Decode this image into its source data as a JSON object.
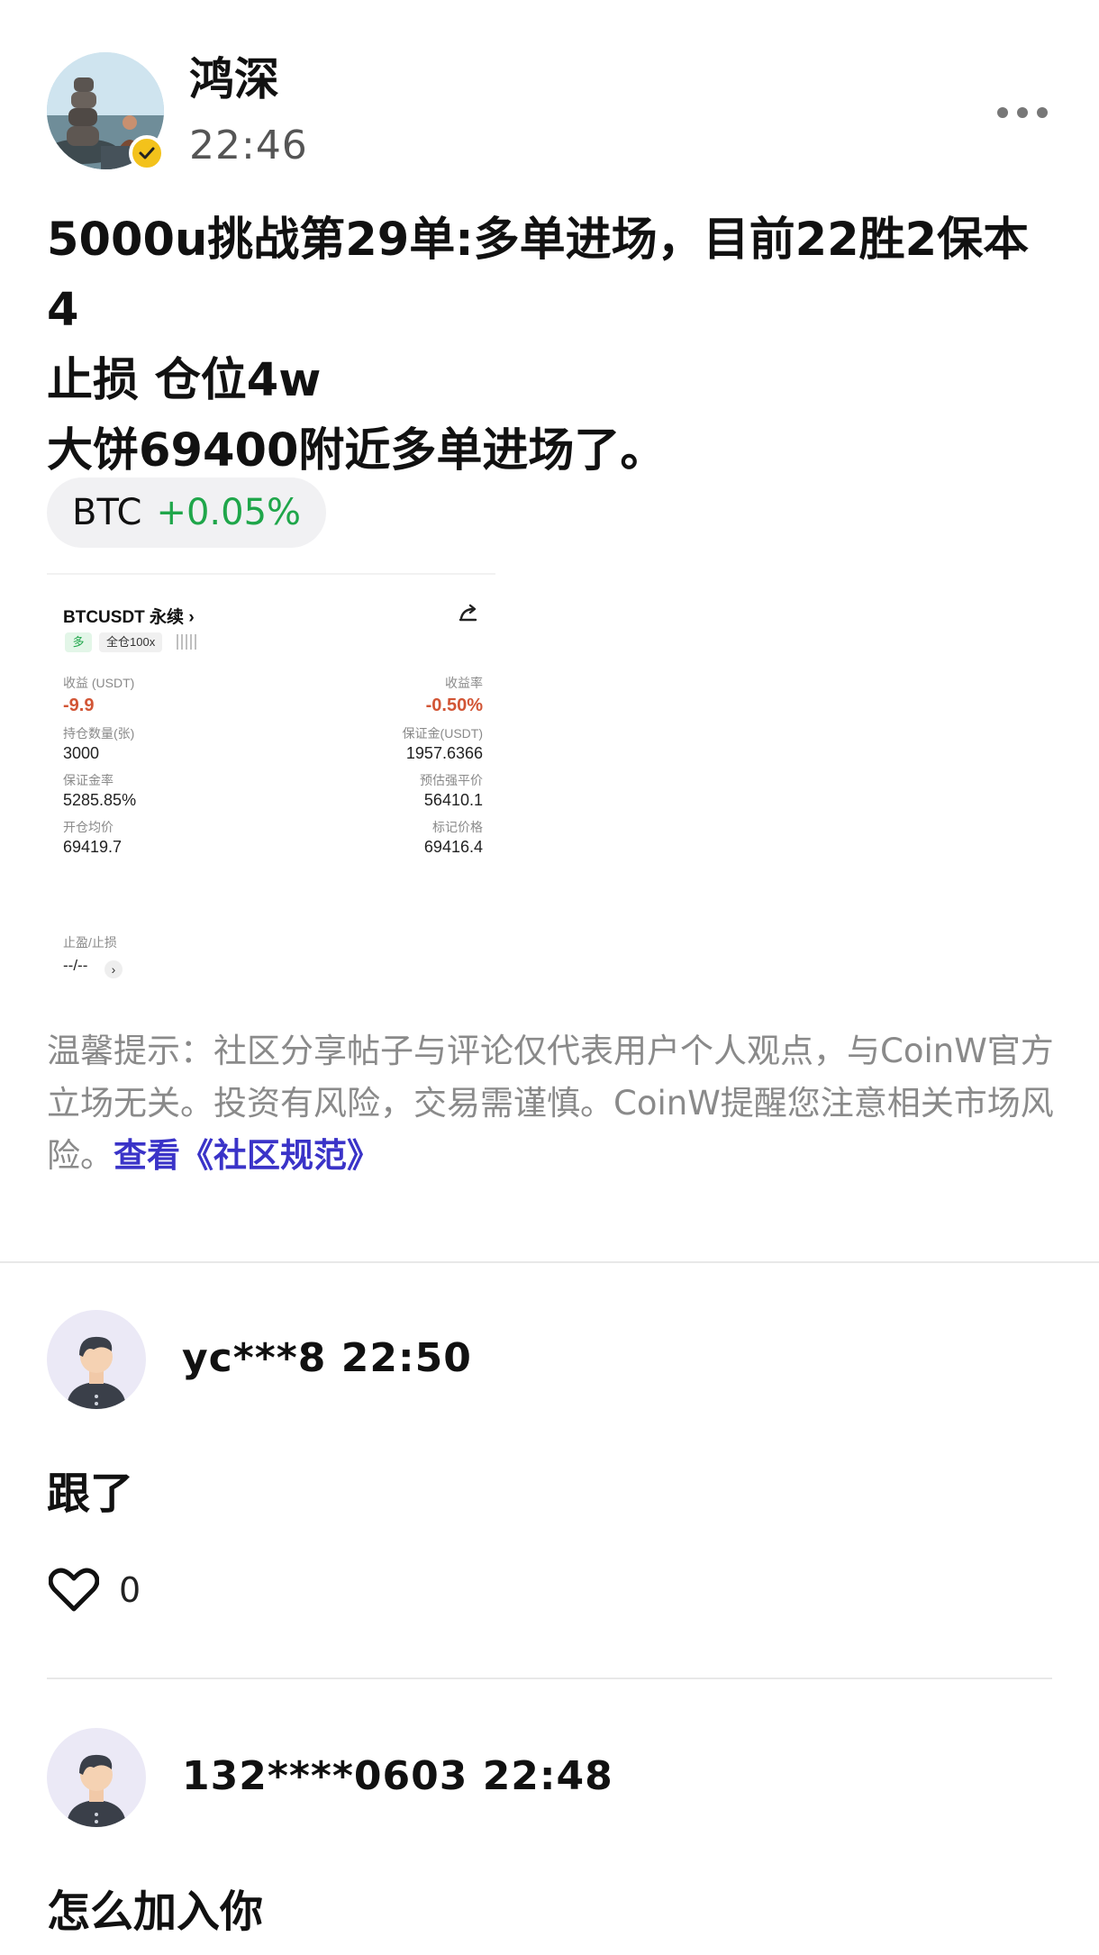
{
  "post": {
    "author": "鸿深",
    "time": "22:46",
    "body": "5000u挑战第29单:多单进场，目前22胜2保本4\n止损 仓位4w\n大饼69400附近多单进场了。",
    "ticker": {
      "symbol": "BTC",
      "change": "+0.05%",
      "change_color": "#1fa64a"
    }
  },
  "position_card": {
    "title": "BTCUSDT 永续 ›",
    "side": "多",
    "leverage": "全仓100x",
    "pnl_label": "收益 (USDT)",
    "pnl_value": "-9.9",
    "roe_label": "收益率",
    "roe_value": "-0.50%",
    "qty_label": "持仓数量(张)",
    "qty_value": "3000",
    "margin_label": "保证金(USDT)",
    "margin_value": "1957.6366",
    "margin_ratio_label": "保证金率",
    "margin_ratio_value": "5285.85%",
    "liq_label": "预估强平价",
    "liq_value": "56410.1",
    "entry_label": "开仓均价",
    "entry_value": "69419.7",
    "mark_label": "标记价格",
    "mark_value": "69416.4",
    "tpsl_label": "止盈/止损",
    "tpsl_value": "--/--",
    "tpsl_chevron": "›",
    "negative_color": "#d25535"
  },
  "disclaimer": {
    "text": "温馨提示：社区分享帖子与评论仅代表用户个人观点，与CoinW官方立场无关。投资有风险，交易需谨慎。CoinW提醒您注意相关市场风险。",
    "link": "查看《社区规范》",
    "link_color": "#3a33c8"
  },
  "comments": [
    {
      "user": "yc***8",
      "time": "22:50",
      "text": "跟了",
      "likes": "0"
    },
    {
      "user": "132****0603",
      "time": "22:48",
      "text": "怎么加入你"
    }
  ]
}
